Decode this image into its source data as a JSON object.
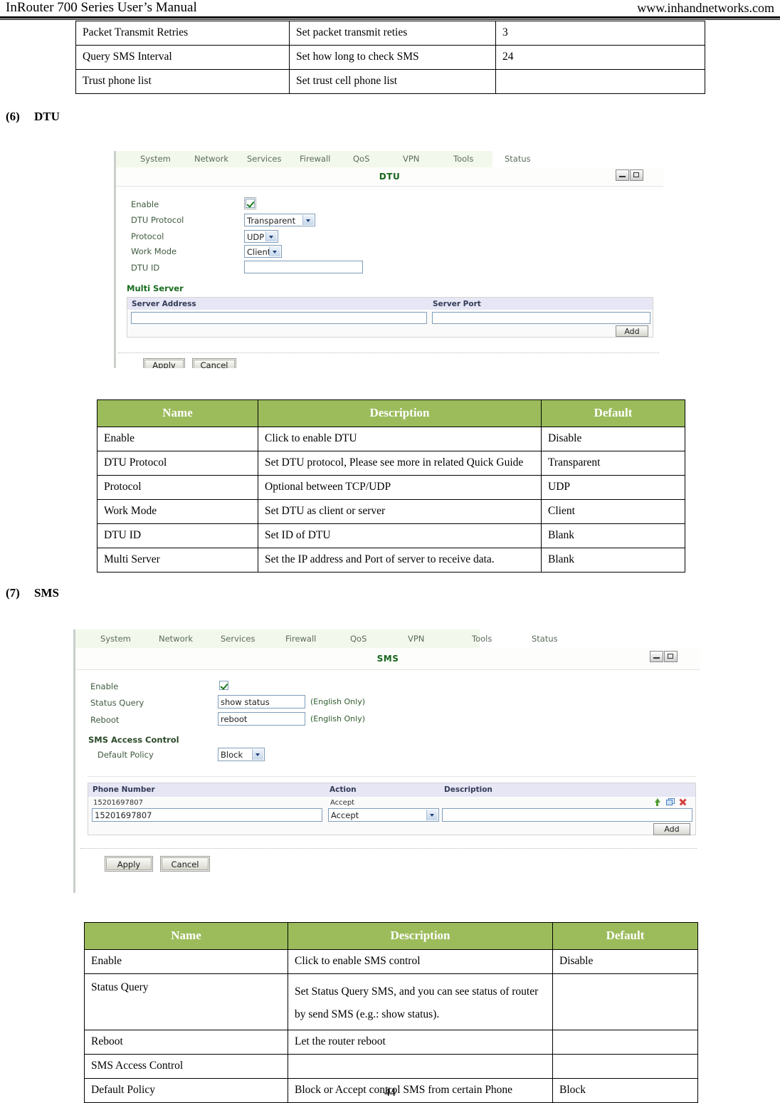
{
  "header": {
    "left": "InRouter 700 Series User’s Manual",
    "right": "www.inhandnetworks.com"
  },
  "footer": {
    "page_number": "44"
  },
  "continued_table": {
    "rows": [
      [
        "Packet Transmit Retries",
        "Set packet transmit reties",
        "3"
      ],
      [
        "Query SMS Interval",
        "Set how long to check SMS",
        "24"
      ],
      [
        "Trust phone list",
        "Set trust cell phone list",
        ""
      ]
    ]
  },
  "sections": {
    "dtu": {
      "number": "(6)",
      "title": "DTU"
    },
    "sms": {
      "number": "(7)",
      "title": "SMS"
    }
  },
  "dtu_screenshot": {
    "nav": [
      "System",
      "Network",
      "Services",
      "Firewall",
      "QoS",
      "VPN",
      "Tools",
      "Status"
    ],
    "window_title": "DTU",
    "fields": {
      "enable_label": "Enable",
      "enable_checked": "on",
      "dtu_protocol_label": "DTU Protocol",
      "dtu_protocol_value": "Transparent",
      "protocol_label": "Protocol",
      "protocol_value": "UDP",
      "work_mode_label": "Work Mode",
      "work_mode_value": "Client",
      "dtu_id_label": "DTU ID",
      "dtu_id_value": ""
    },
    "multi_server": {
      "heading": "Multi Server",
      "col_address": "Server Address",
      "col_port": "Server Port",
      "address_value": "",
      "port_value": "",
      "add_label": "Add"
    },
    "buttons": {
      "apply": "Apply",
      "cancel": "Cancel"
    }
  },
  "dtu_table": {
    "columns": [
      "Name",
      "Description",
      "Default"
    ],
    "rows": [
      [
        "Enable",
        "Click to enable DTU",
        "Disable"
      ],
      [
        "DTU Protocol",
        "Set DTU protocol, Please see more in related Quick Guide",
        "Transparent"
      ],
      [
        "Protocol",
        "Optional between TCP/UDP",
        "UDP"
      ],
      [
        "Work Mode",
        "Set DTU as client or server",
        "Client"
      ],
      [
        "DTU ID",
        "Set ID of DTU",
        "Blank"
      ],
      [
        "Multi Server",
        "Set the IP address and Port of server to receive data.",
        "Blank"
      ]
    ]
  },
  "sms_screenshot": {
    "nav": [
      "System",
      "Network",
      "Services",
      "Firewall",
      "QoS",
      "VPN",
      "Tools",
      "Status"
    ],
    "window_title": "SMS",
    "fields": {
      "enable_label": "Enable",
      "enable_checked": "on",
      "status_query_label": "Status Query",
      "status_query_value": "show status",
      "status_query_hint": "(English Only)",
      "reboot_label": "Reboot",
      "reboot_value": "reboot",
      "reboot_hint": "(English Only)",
      "access_control_heading": "SMS Access Control",
      "default_policy_label": "Default Policy",
      "default_policy_value": "Block"
    },
    "phone_grid": {
      "col_phone": "Phone Number",
      "col_action": "Action",
      "col_description": "Description",
      "existing_row": {
        "phone": "15201697807",
        "action": "Accept",
        "description": ""
      },
      "input_phone": "15201697807",
      "input_action": "Accept",
      "input_description": "",
      "add_label": "Add",
      "icons": [
        "move-up-icon",
        "copy-icon",
        "delete-icon"
      ]
    },
    "buttons": {
      "apply": "Apply",
      "cancel": "Cancel"
    }
  },
  "sms_table": {
    "columns": [
      "Name",
      "Description",
      "Default"
    ],
    "rows": [
      [
        "Enable",
        "Click to enable SMS control",
        "Disable"
      ],
      [
        "Status Query",
        "Set Status Query SMS, and you can see status of router|by send SMS (e.g.: show status).",
        ""
      ],
      [
        "Reboot",
        "Let the router reboot",
        ""
      ],
      [
        "SMS Access Control",
        "",
        ""
      ],
      [
        "Default Policy",
        "Block or Accept control SMS from certain Phone",
        "Block"
      ]
    ]
  },
  "colors": {
    "table_header_green": "#9cbc5c",
    "ui_nav_bg": "#f3f8ec",
    "ui_title_green": "#15651b",
    "grid_header_lavender": "#e6e6f5"
  }
}
